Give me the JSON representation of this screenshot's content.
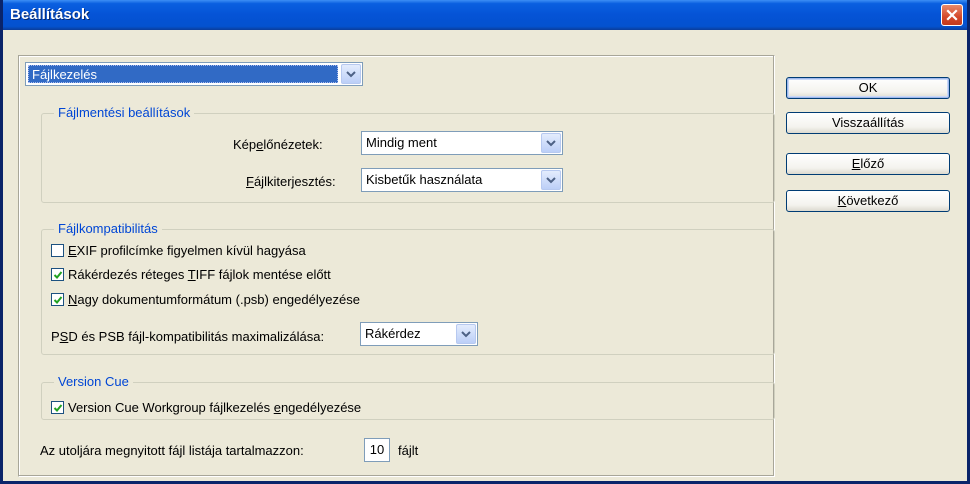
{
  "window": {
    "title": "Beállítások",
    "close_glyph": "×"
  },
  "page_select": {
    "value": "Fájlkezelés"
  },
  "file_save_group": {
    "title": "Fájlmentési beállítások",
    "image_previews": {
      "label_pre": "Kép",
      "label_u": "e",
      "label_post": "lőnézetek:",
      "value": "Mindig ment"
    },
    "file_extension": {
      "label_pre": "",
      "label_u": "F",
      "label_post": "ájlkiterjesztés:",
      "value": "Kisbetűk használata"
    }
  },
  "compat_group": {
    "title": "Fájlkompatibilitás",
    "exif": {
      "checked": false,
      "pre": "",
      "u": "E",
      "post": "XIF profilcímke figyelmen kívül hagyása"
    },
    "tiff": {
      "checked": true,
      "pre": "Rákérdezés réteges ",
      "u": "T",
      "post": "IFF fájlok mentése előtt"
    },
    "psb": {
      "checked": true,
      "pre": "",
      "u": "N",
      "post": "agy dokumentumformátum (.psb) engedélyezése"
    },
    "maximize": {
      "label_pre": "P",
      "label_u": "S",
      "label_post": "D és PSB fájl-kompatibilitás maximalizálása:",
      "value": "Rákérdez"
    }
  },
  "version_cue_group": {
    "title": "Version Cue",
    "workgroup": {
      "checked": true,
      "pre": "Version Cue Workgroup fájlkezelés ",
      "u": "e",
      "post": "ngedélyezése"
    }
  },
  "recent_files": {
    "label": "Az utoljára megnyitott fájl listája tartalmazzon:",
    "value": "10",
    "suffix": "fájlt"
  },
  "buttons": {
    "ok": "OK",
    "reset": "Visszaállítás",
    "prev_u": "E",
    "prev_rest": "lőző",
    "next_u": "K",
    "next_rest": "övetkező"
  },
  "icons": {
    "dropdown": "chevron-down-icon",
    "check": "check-icon",
    "close": "close-icon"
  },
  "colors": {
    "titlebar": "#0553d6",
    "group_title": "#0046d5",
    "selection": "#316ac5",
    "close_button": "#d4482a"
  }
}
